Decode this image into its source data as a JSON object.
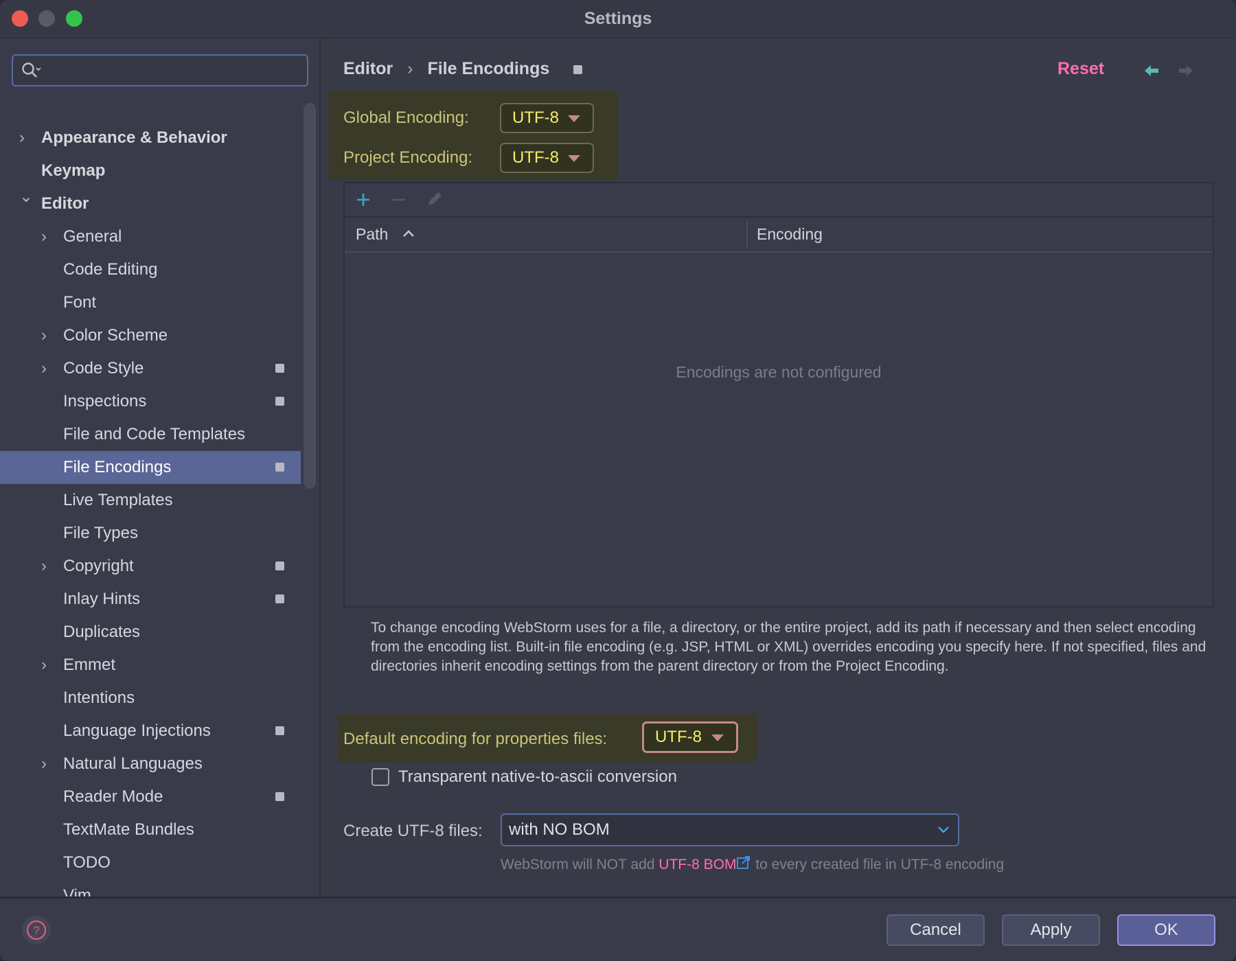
{
  "window": {
    "title": "Settings"
  },
  "search": {
    "placeholder": ""
  },
  "sidebar": {
    "items": [
      {
        "label": "Appearance & Behavior",
        "level": 0,
        "chevron": "right",
        "bold": true
      },
      {
        "label": "Keymap",
        "level": 0,
        "chevron": "none",
        "bold": true
      },
      {
        "label": "Editor",
        "level": 0,
        "chevron": "down",
        "bold": true
      },
      {
        "label": "General",
        "level": 1,
        "chevron": "right"
      },
      {
        "label": "Code Editing",
        "level": 1,
        "chevron": "none"
      },
      {
        "label": "Font",
        "level": 1,
        "chevron": "none"
      },
      {
        "label": "Color Scheme",
        "level": 1,
        "chevron": "right"
      },
      {
        "label": "Code Style",
        "level": 1,
        "chevron": "right",
        "badge": true
      },
      {
        "label": "Inspections",
        "level": 1,
        "chevron": "none",
        "badge": true
      },
      {
        "label": "File and Code Templates",
        "level": 1,
        "chevron": "none"
      },
      {
        "label": "File Encodings",
        "level": 1,
        "chevron": "none",
        "badge": true,
        "selected": true
      },
      {
        "label": "Live Templates",
        "level": 1,
        "chevron": "none"
      },
      {
        "label": "File Types",
        "level": 1,
        "chevron": "none"
      },
      {
        "label": "Copyright",
        "level": 1,
        "chevron": "right",
        "badge": true
      },
      {
        "label": "Inlay Hints",
        "level": 1,
        "chevron": "none",
        "badge": true
      },
      {
        "label": "Duplicates",
        "level": 1,
        "chevron": "none"
      },
      {
        "label": "Emmet",
        "level": 1,
        "chevron": "right"
      },
      {
        "label": "Intentions",
        "level": 1,
        "chevron": "none"
      },
      {
        "label": "Language Injections",
        "level": 1,
        "chevron": "none",
        "badge": true
      },
      {
        "label": "Natural Languages",
        "level": 1,
        "chevron": "right"
      },
      {
        "label": "Reader Mode",
        "level": 1,
        "chevron": "none",
        "badge": true
      },
      {
        "label": "TextMate Bundles",
        "level": 1,
        "chevron": "none"
      },
      {
        "label": "TODO",
        "level": 1,
        "chevron": "none"
      },
      {
        "label": "Vim",
        "level": 1,
        "chevron": "none"
      }
    ]
  },
  "breadcrumb": {
    "parent": "Editor",
    "separator": "›",
    "current": "File Encodings"
  },
  "header": {
    "reset": "Reset"
  },
  "global_encoding": {
    "label": "Global Encoding:",
    "value": "UTF-8"
  },
  "project_encoding": {
    "label": "Project Encoding:",
    "value": "UTF-8"
  },
  "table": {
    "columns": [
      "Path",
      "Encoding"
    ],
    "sort": "ascending",
    "empty_text": "Encodings are not configured",
    "rows": []
  },
  "description": "To change encoding WebStorm uses for a file, a directory, or the entire project, add its path if necessary and then select encoding from the encoding list. Built-in file encoding (e.g. JSP, HTML or XML) overrides encoding you specify here. If not specified, files and directories inherit encoding settings from the parent directory or from the Project Encoding.",
  "properties_encoding": {
    "label": "Default encoding for properties files:",
    "value": "UTF-8"
  },
  "native_to_ascii": {
    "label": "Transparent native-to-ascii conversion",
    "checked": false
  },
  "create_utf8": {
    "label": "Create UTF-8 files:",
    "value": "with NO BOM"
  },
  "hint": {
    "before": "WebStorm will NOT add ",
    "link": "UTF-8 BOM",
    "after": " to every created file in UTF-8 encoding"
  },
  "buttons": {
    "cancel": "Cancel",
    "apply": "Apply",
    "ok": "OK"
  },
  "colors": {
    "accent": "#ff6eb4",
    "highlight": "#393a28",
    "selection": "#5a6796"
  }
}
